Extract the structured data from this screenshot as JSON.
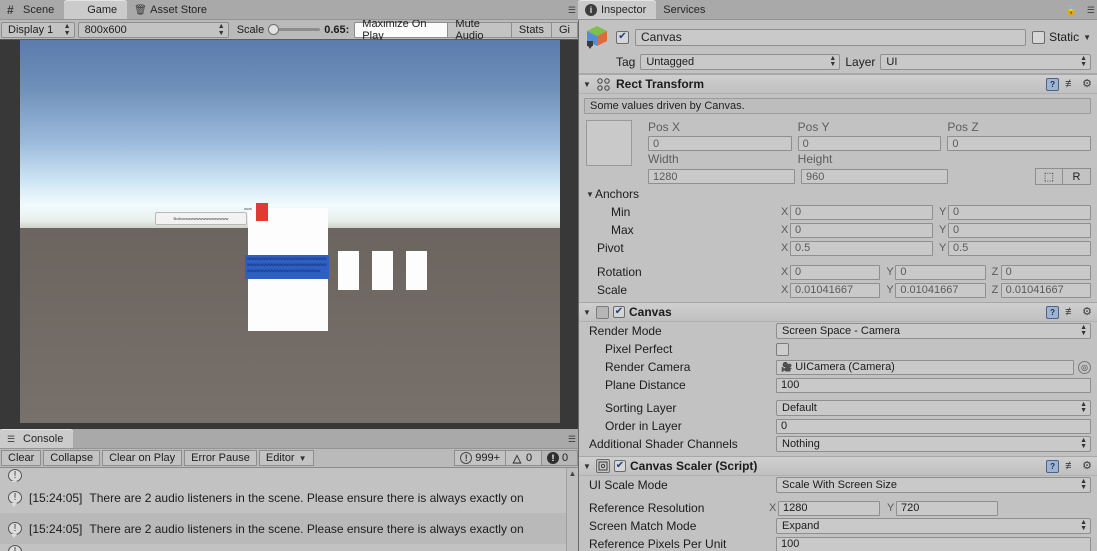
{
  "game_panel": {
    "tabs": [
      {
        "label": "Scene",
        "icon": "grid-icon",
        "active": false
      },
      {
        "label": "Game",
        "icon": "game-icon",
        "active": true
      },
      {
        "label": "Asset Store",
        "icon": "asset-store-icon",
        "active": false
      }
    ],
    "toolbar": {
      "display": "Display 1",
      "resolution": "800x600",
      "scale_label": "Scale",
      "scale_value": "0.65:",
      "maximize_on_play": "Maximize On Play",
      "mute_audio": "Mute Audio",
      "stats": "Stats",
      "gizmos": "Gi"
    },
    "view": {
      "button_label": "Buttonwwwwwwwwwwwwwww",
      "tiny_label": "www",
      "blue_bar_text": "wwwwwwwwwwwwwwwwwwwwwwwwwwwwwwwwwwwwwwwwwwwwwwwwwwwwwwwwwwwwwwwwwwwwwwwwwwww"
    }
  },
  "console": {
    "tab_label": "Console",
    "toolbar": {
      "clear": "Clear",
      "collapse": "Collapse",
      "clear_on_play": "Clear on Play",
      "error_pause": "Error Pause",
      "editor": "Editor",
      "info_count": "999+",
      "warning_count": "0",
      "error_count": "0"
    },
    "messages": [
      {
        "time": "[15:24:05]",
        "text": "There are 2 audio listeners in the scene. Please ensure there is always exactly on"
      },
      {
        "time": "[15:24:05]",
        "text": "There are 2 audio listeners in the scene. Please ensure there is always exactly on"
      }
    ]
  },
  "inspector": {
    "tabs": [
      {
        "label": "Inspector",
        "active": true
      },
      {
        "label": "Services",
        "active": false
      }
    ],
    "gameobject": {
      "name": "Canvas",
      "enabled": true,
      "static_label": "Static",
      "tag_label": "Tag",
      "tag_value": "Untagged",
      "layer_label": "Layer",
      "layer_value": "UI"
    },
    "rect_transform": {
      "title": "Rect Transform",
      "info": "Some values driven by Canvas.",
      "pos_x_label": "Pos X",
      "pos_y_label": "Pos Y",
      "pos_z_label": "Pos Z",
      "pos_x": "0",
      "pos_y": "0",
      "pos_z": "0",
      "width_label": "Width",
      "height_label": "Height",
      "width": "1280",
      "height": "960",
      "blueprint_btn": "⬚",
      "raw_btn": "R",
      "anchors_label": "Anchors",
      "min_label": "Min",
      "min_x": "0",
      "min_y": "0",
      "max_label": "Max",
      "max_x": "0",
      "max_y": "0",
      "pivot_label": "Pivot",
      "pivot_x": "0.5",
      "pivot_y": "0.5",
      "rotation_label": "Rotation",
      "rot_x": "0",
      "rot_y": "0",
      "rot_z": "0",
      "scale_label": "Scale",
      "scale_x": "0.01041667",
      "scale_y": "0.01041667",
      "scale_z": "0.01041667"
    },
    "canvas": {
      "title": "Canvas",
      "enabled": true,
      "render_mode_label": "Render Mode",
      "render_mode": "Screen Space - Camera",
      "pixel_perfect_label": "Pixel Perfect",
      "pixel_perfect": false,
      "render_camera_label": "Render Camera",
      "render_camera": "UICamera (Camera)",
      "plane_distance_label": "Plane Distance",
      "plane_distance": "100",
      "sorting_layer_label": "Sorting Layer",
      "sorting_layer": "Default",
      "order_in_layer_label": "Order in Layer",
      "order_in_layer": "0",
      "shader_channels_label": "Additional Shader Channels",
      "shader_channels": "Nothing"
    },
    "canvas_scaler": {
      "title": "Canvas Scaler (Script)",
      "enabled": true,
      "ui_scale_mode_label": "UI Scale Mode",
      "ui_scale_mode": "Scale With Screen Size",
      "reference_resolution_label": "Reference Resolution",
      "ref_res_x": "1280",
      "ref_res_y": "720",
      "screen_match_mode_label": "Screen Match Mode",
      "screen_match_mode": "Expand",
      "ref_pixels_label": "Reference Pixels Per Unit",
      "ref_pixels": "100"
    },
    "axis_x": "X",
    "axis_y": "Y",
    "axis_z": "Z"
  }
}
